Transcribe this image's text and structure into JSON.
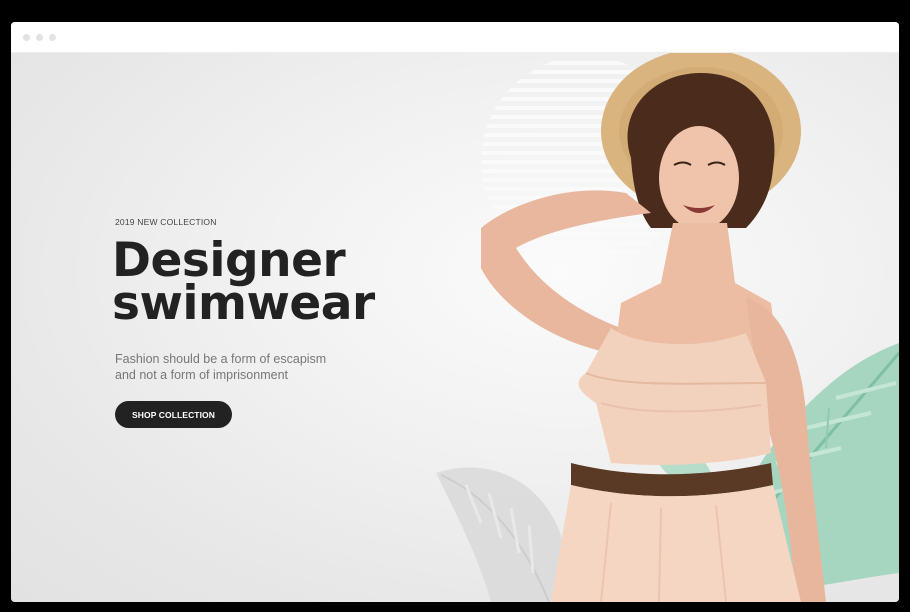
{
  "hero": {
    "kicker": "2019 NEW COLLECTION",
    "headline_line1": "Designer",
    "headline_line2": "swimwear",
    "sub_line1": "Fashion should be a form of escapism",
    "sub_line2": "and not a form of imprisonment",
    "cta_label": "SHOP COLLECTION"
  },
  "colors": {
    "text_dark": "#222222",
    "text_muted": "#777777",
    "button_bg": "#222222",
    "button_text": "#ffffff",
    "leaf_green": "#8fcbb0",
    "dress_peach": "#f3d2bd"
  }
}
